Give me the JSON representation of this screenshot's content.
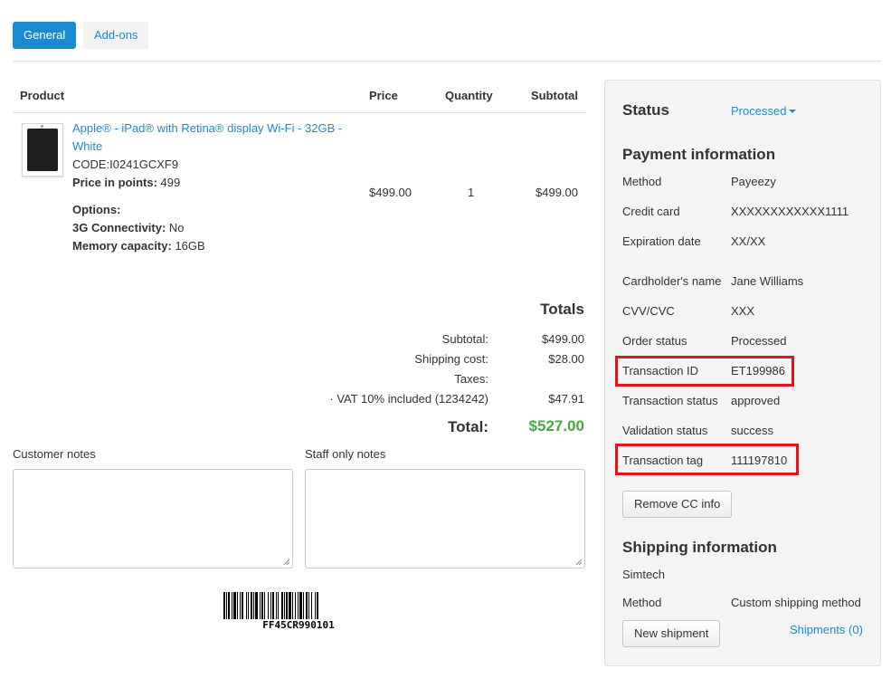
{
  "tabs": [
    {
      "label": "General",
      "active": true
    },
    {
      "label": "Add-ons",
      "active": false
    }
  ],
  "table": {
    "headers": {
      "product": "Product",
      "price": "Price",
      "quantity": "Quantity",
      "subtotal": "Subtotal"
    },
    "item": {
      "name_line1": "Apple® - iPad® with Retina® display Wi-Fi - 32GB -",
      "name_line2": "White",
      "code": "CODE:I0241GCXF9",
      "points_label": "Price in points:",
      "points_value": "499",
      "options_label": "Options:",
      "option1_label": "3G Connectivity:",
      "option1_value": "No",
      "option2_label": "Memory capacity:",
      "option2_value": "16GB",
      "price": "$499.00",
      "quantity": "1",
      "subtotal": "$499.00",
      "thumbnail_icon": "ipad-thumbnail-icon"
    }
  },
  "totals": {
    "title": "Totals",
    "subtotal_label": "Subtotal:",
    "subtotal_value": "$499.00",
    "shipping_label": "Shipping cost:",
    "shipping_value": "$28.00",
    "taxes_label": "Taxes:",
    "vat_label": "· VAT 10% included (1234242)",
    "vat_value": "$47.91",
    "total_label": "Total:",
    "total_value": "$527.00",
    "total_color": "#4aa744"
  },
  "notes": {
    "customer_label": "Customer notes",
    "staff_label": "Staff only notes"
  },
  "barcode": {
    "text": "FF45CR990101"
  },
  "sidebar": {
    "status_heading": "Status",
    "status_value": "Processed",
    "payment_heading": "Payment information",
    "payment_rows": [
      {
        "label": "Method",
        "value": "Payeezy"
      },
      {
        "label": "Credit card",
        "value": "XXXXXXXXXXXX1111"
      },
      {
        "label": "Expiration date",
        "value": "XX/XX"
      },
      {
        "label": "Cardholder's name",
        "value": "Jane Williams"
      },
      {
        "label": "CVV/CVC",
        "value": "XXX"
      },
      {
        "label": "Order status",
        "value": "Processed"
      },
      {
        "label": "Transaction ID",
        "value": "ET199986"
      },
      {
        "label": "Transaction status",
        "value": "approved"
      },
      {
        "label": "Validation status",
        "value": "success"
      },
      {
        "label": "Transaction tag",
        "value": "111197810"
      }
    ],
    "remove_cc_button": "Remove CC info",
    "shipping_heading": "Shipping information",
    "shipping_carrier": "Simtech",
    "shipping_method_label": "Method",
    "shipping_method_value": "Custom shipping method",
    "new_shipment_button": "New shipment",
    "shipments_link": "Shipments (0)",
    "highlight_color": "#e0151b",
    "accent_color": "#1b8bd1"
  }
}
